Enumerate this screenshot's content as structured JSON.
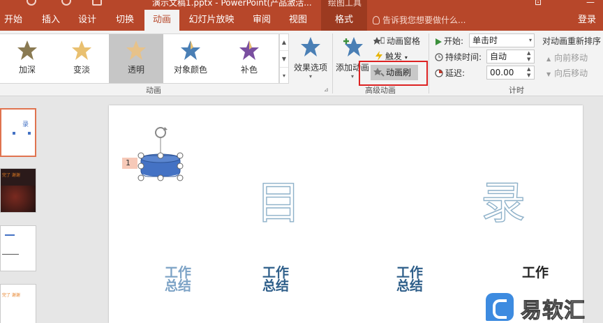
{
  "title_bar": {
    "title": "演示文稿1.pptx - PowerPoint(产品激活...",
    "context_tools": "绘图工具"
  },
  "tabs": [
    {
      "label": "开始"
    },
    {
      "label": "插入"
    },
    {
      "label": "设计"
    },
    {
      "label": "切换"
    },
    {
      "label": "动画",
      "active": true
    },
    {
      "label": "幻灯片放映"
    },
    {
      "label": "审阅"
    },
    {
      "label": "视图"
    },
    {
      "label": "格式"
    }
  ],
  "tell_me": "告诉我您想要做什么...",
  "login": "登录",
  "animation_gallery": {
    "items": [
      {
        "label": "加深",
        "star_color": "#8a7a52"
      },
      {
        "label": "变淡",
        "star_color": "#e9c070"
      },
      {
        "label": "透明",
        "star_color": "#e7c28a",
        "selected": true
      },
      {
        "label": "对象颜色",
        "star_color": "#4a7fb5"
      },
      {
        "label": "补色",
        "star_color": "#7a4fa0"
      }
    ],
    "group_label": "动画"
  },
  "effect_options": {
    "label": "效果选项"
  },
  "advanced": {
    "add_animation": "添加动画",
    "animation_pane": "动画窗格",
    "trigger": "触发",
    "animation_painter": "动画刷",
    "group_label": "高级动画"
  },
  "timing": {
    "start_label": "开始:",
    "start_value": "单击时",
    "duration_label": "持续时间:",
    "duration_value": "自动",
    "delay_label": "延迟:",
    "delay_value": "00.00",
    "group_label": "计时"
  },
  "reorder": {
    "title": "对动画重新排序",
    "move_earlier": "向前移动",
    "move_later": "向后移动"
  },
  "slide": {
    "anim_number": "1",
    "char_mu": "目",
    "char_lu": "录",
    "work_summary": [
      "工作",
      "总结"
    ]
  },
  "thumbnails": [
    {
      "text": "录"
    },
    {
      "text": "完了 谢谢"
    },
    {
      "text": ""
    },
    {
      "text": "完了 谢谢"
    }
  ],
  "watermark": "易软汇",
  "colors": {
    "accent": "#b7472a",
    "highlight": "#dd2222",
    "shape_fill": "#4472c4"
  }
}
